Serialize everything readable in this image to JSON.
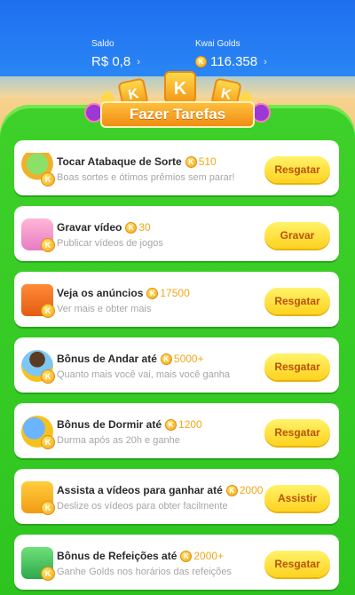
{
  "header": {
    "balance_label": "Saldo",
    "balance_value": "R$ 0,8",
    "golds_label": "Kwai Golds",
    "golds_value": "116.358",
    "chevron": "›"
  },
  "banner": {
    "title": "Fazer Tarefas",
    "block_letter": "K"
  },
  "coin_letter": "K",
  "tasks": [
    {
      "icon": "drum-icon",
      "title": "Tocar Atabaque de Sorte",
      "reward": "510",
      "description": "Boas sortes e ótimos prêmios sem parar!",
      "button": "Resgatar"
    },
    {
      "icon": "record-video-icon",
      "title": "Gravar vídeo",
      "reward": "30",
      "description": "Publicar vídeos de jogos",
      "button": "Gravar"
    },
    {
      "icon": "tv-icon",
      "title": "Veja os anúncios",
      "reward": "17500",
      "description": "Ver mais e obter mais",
      "button": "Resgatar"
    },
    {
      "icon": "walking-person-icon",
      "title": "Bônus de Andar até",
      "reward": "5000+",
      "description": "Quanto mais você vai, mais você ganha",
      "button": "Resgatar"
    },
    {
      "icon": "sleep-icon",
      "title": "Bônus de Dormir até",
      "reward": "1200",
      "description": "Durma após as 20h e ganhe",
      "button": "Resgatar"
    },
    {
      "icon": "video-camera-icon",
      "title": "Assista a vídeos para ganhar até",
      "reward": "2000",
      "description": "Deslize os vídeos para obter facilmente",
      "button": "Assistir"
    },
    {
      "icon": "meal-icon",
      "title": "Bônus de Refeições até",
      "reward": "2000+",
      "description": "Ganhe Golds nos horários das refeições",
      "button": "Resgatar"
    }
  ],
  "colors": {
    "topbar": "#2a86f4",
    "panel": "#3fd12a",
    "button": "#ffd21f",
    "button_text": "#b8530a",
    "reward": "#f0a81a"
  }
}
